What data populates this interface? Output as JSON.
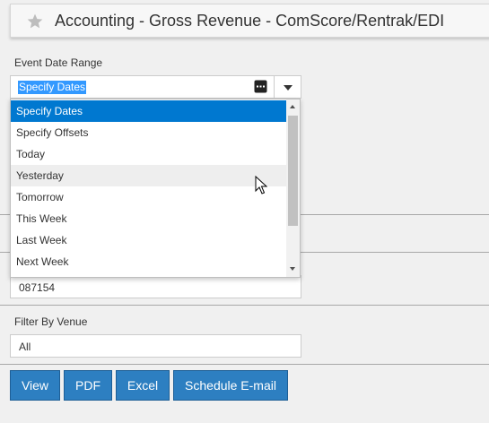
{
  "header": {
    "title": "Accounting - Gross Revenue - ComScore/Rentrak/EDI",
    "star_icon": "star-icon"
  },
  "event_date_range": {
    "label": "Event Date Range",
    "value": "Specify Dates",
    "calendar_icon": "calendar-icon",
    "options": [
      "Specify Dates",
      "Specify Offsets",
      "Today",
      "Yesterday",
      "Tomorrow",
      "This Week",
      "Last Week",
      "Next Week"
    ],
    "selected_option": "Specify Dates",
    "hovered_option": "Yesterday"
  },
  "hidden_field": {
    "value": "087154"
  },
  "filter_by_venue": {
    "label": "Filter By Venue",
    "value": "All"
  },
  "buttons": {
    "view": "View",
    "pdf": "PDF",
    "excel": "Excel",
    "schedule_email": "Schedule E-mail"
  },
  "colors": {
    "accent": "#2d7fc1",
    "selected_option": "#0078d0",
    "text_selection": "#3399ff"
  }
}
